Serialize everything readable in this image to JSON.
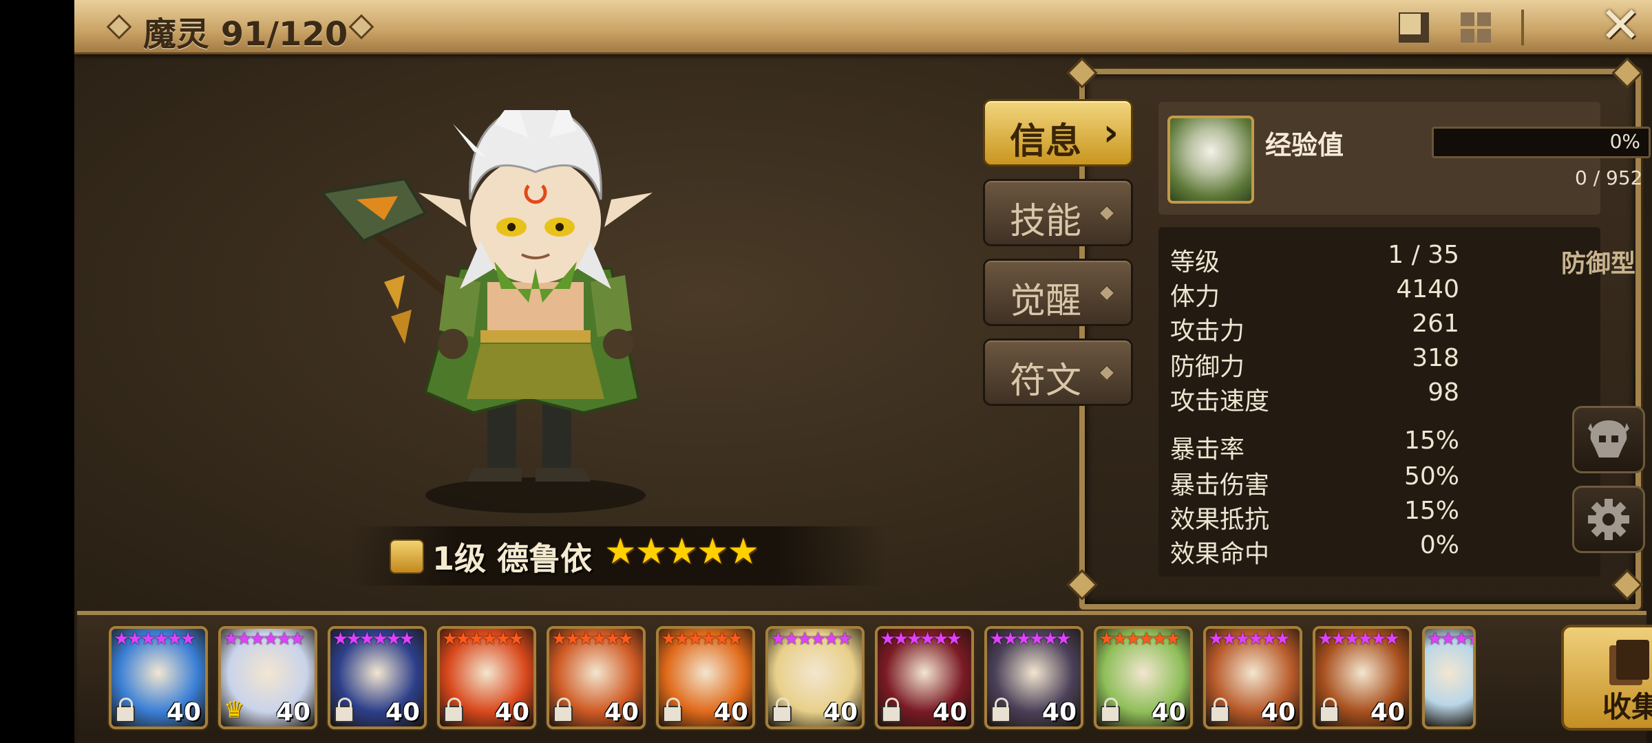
{
  "header": {
    "title": "魔灵 91/120"
  },
  "monster": {
    "level_label": "1级",
    "name": "德鲁依",
    "stars": "★★★★★"
  },
  "tabs": [
    {
      "label": "信息"
    },
    {
      "label": "技能"
    },
    {
      "label": "觉醒"
    },
    {
      "label": "符文"
    }
  ],
  "experience": {
    "label": "经验值",
    "percent": "0%",
    "value": "0 / 952"
  },
  "stats": {
    "type": "防御型",
    "rows": [
      {
        "label": "等级",
        "value": "1 / 35"
      },
      {
        "label": "体力",
        "value": "4140"
      },
      {
        "label": "攻击力",
        "value": "261"
      },
      {
        "label": "防御力",
        "value": "318"
      },
      {
        "label": "攻击速度",
        "value": "98"
      },
      {
        "label": "暴击率",
        "value": "15%"
      },
      {
        "label": "暴击伤害",
        "value": "50%"
      },
      {
        "label": "效果抵抗",
        "value": "15%"
      },
      {
        "label": "效果命中",
        "value": "0%"
      }
    ]
  },
  "roster": {
    "cards": [
      {
        "level": "40",
        "star_color": "#e040ff",
        "bg": "#3a7fd6",
        "badge": "lock"
      },
      {
        "level": "40",
        "star_color": "#e040ff",
        "bg": "#c9d3ea",
        "badge": "crown"
      },
      {
        "level": "40",
        "star_color": "#e040ff",
        "bg": "#2d3f8a",
        "badge": "lock"
      },
      {
        "level": "40",
        "star_color": "#ff5a1a",
        "bg": "#d9481c",
        "badge": "lock"
      },
      {
        "level": "40",
        "star_color": "#ff5a1a",
        "bg": "#cf5a24",
        "badge": "lock"
      },
      {
        "level": "40",
        "star_color": "#ff5a1a",
        "bg": "#e06a1a",
        "badge": "lock"
      },
      {
        "level": "40",
        "star_color": "#e040ff",
        "bg": "#e8d08a",
        "badge": "lock"
      },
      {
        "level": "40",
        "star_color": "#e040ff",
        "bg": "#7a1a24",
        "badge": "lock"
      },
      {
        "level": "40",
        "star_color": "#e040ff",
        "bg": "#4a4058",
        "badge": "lock"
      },
      {
        "level": "40",
        "star_color": "#ff5a1a",
        "bg": "#8fbf5a",
        "badge": "lock"
      },
      {
        "level": "40",
        "star_color": "#e040ff",
        "bg": "#b85a2a",
        "badge": "lock"
      },
      {
        "level": "40",
        "star_color": "#e040ff",
        "bg": "#a8501e",
        "badge": "lock"
      },
      {
        "level": "",
        "star_color": "#e040ff",
        "bg": "#b9d6e8",
        "badge": "none"
      }
    ],
    "collect_label": "收集"
  }
}
